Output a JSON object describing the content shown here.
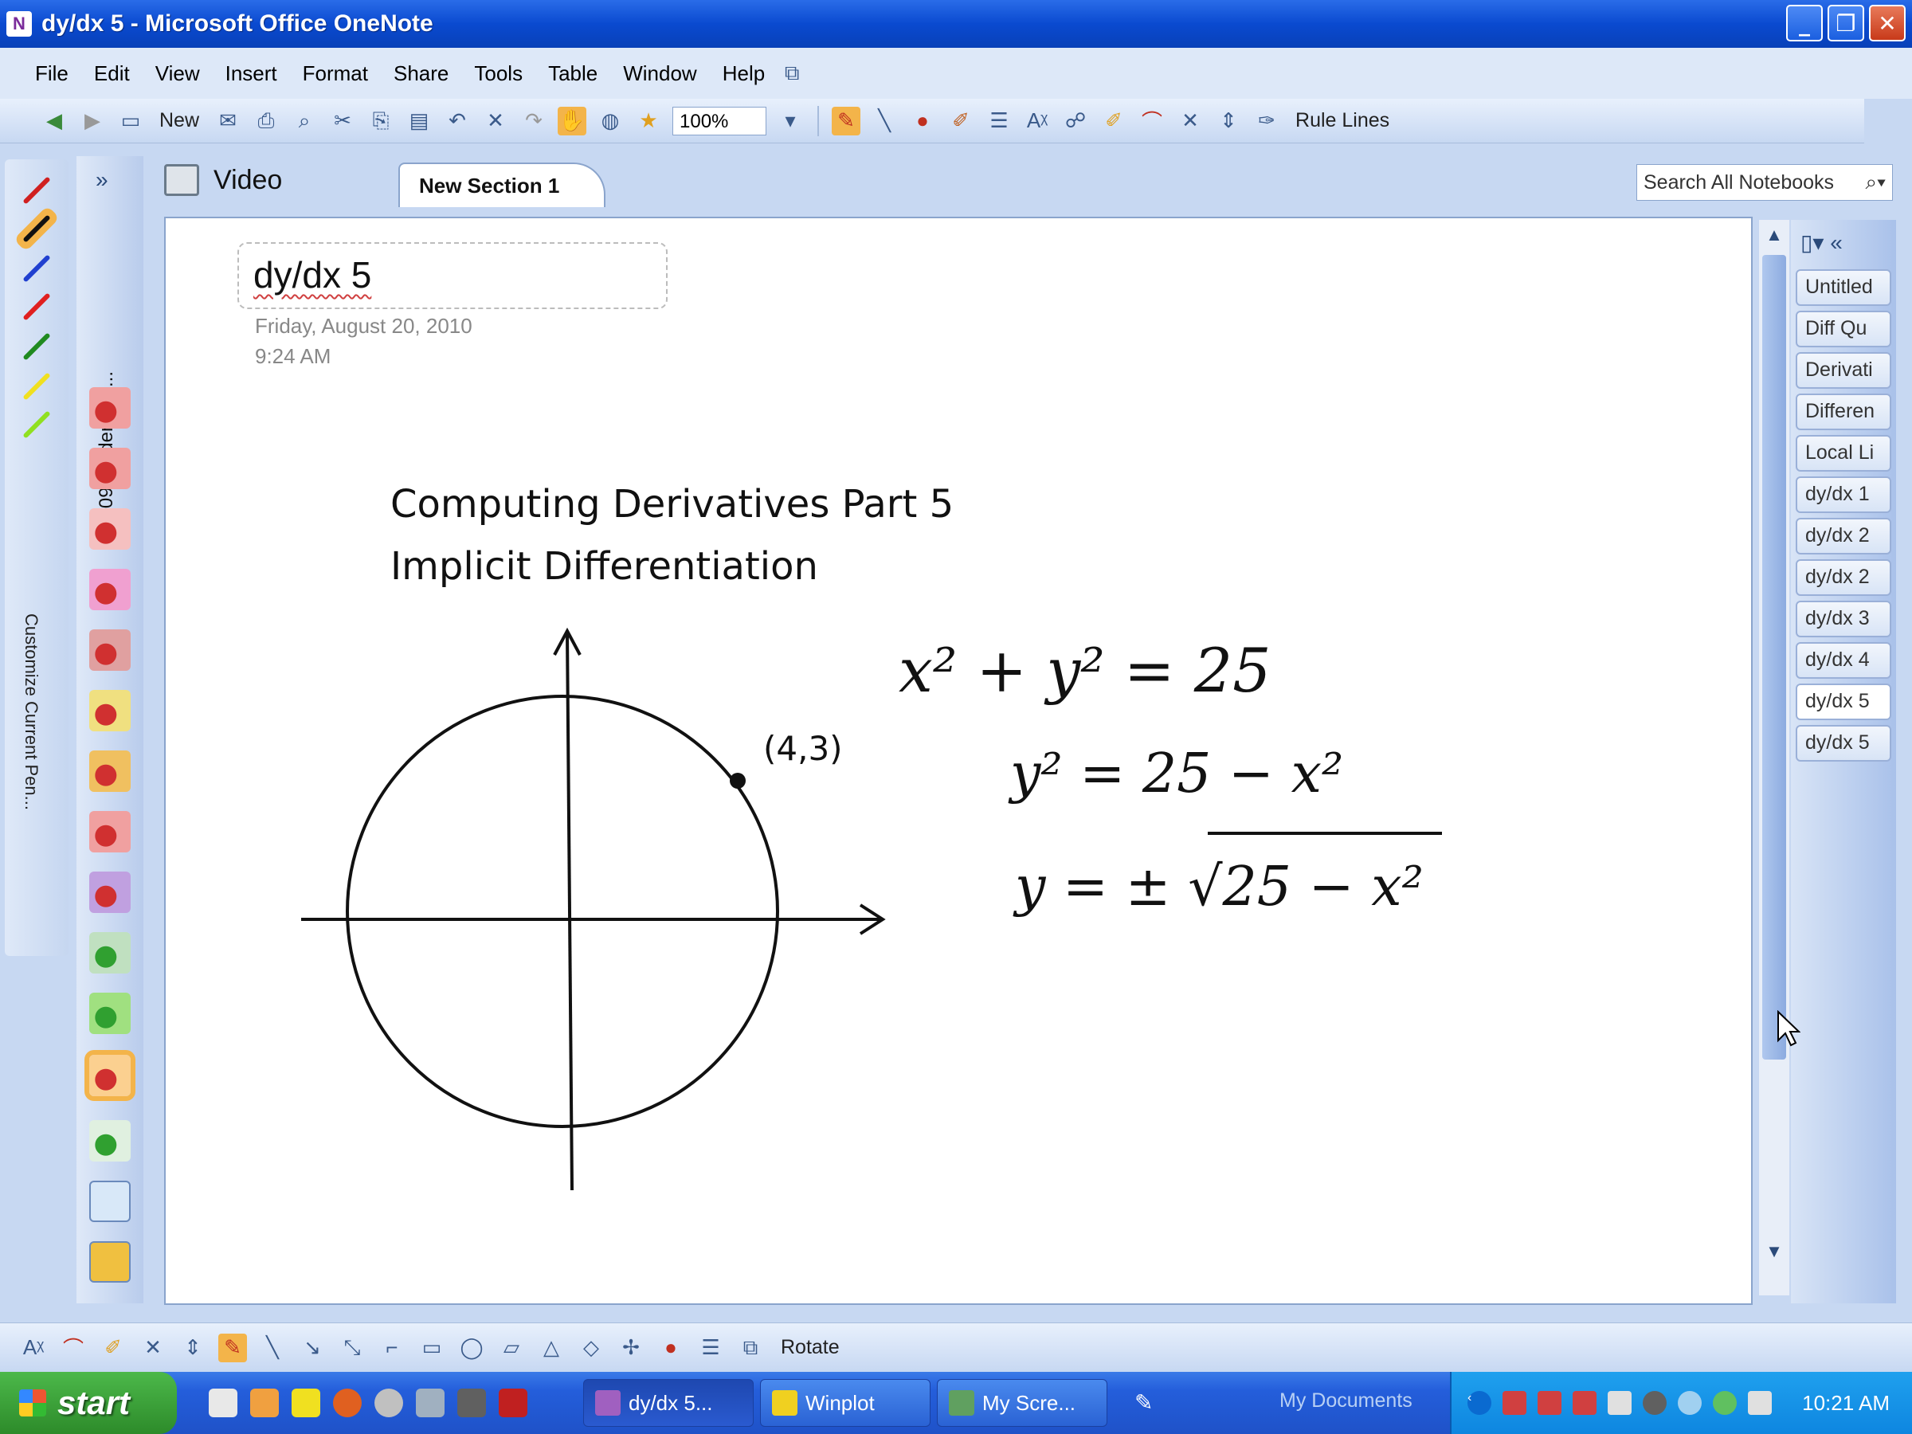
{
  "window": {
    "title": "dy/dx 5 - Microsoft Office OneNote"
  },
  "menu": [
    "File",
    "Edit",
    "View",
    "Insert",
    "Format",
    "Share",
    "Tools",
    "Table",
    "Window",
    "Help"
  ],
  "toolbar": {
    "new_label": "New",
    "zoom": "100%",
    "rule_lines": "Rule Lines"
  },
  "notebook": {
    "name": "Video",
    "section": "New Section 1",
    "nav_label": "2009 Student Su..."
  },
  "search": {
    "placeholder": "Search All Notebooks"
  },
  "pen_label": "Customize Current Pen...",
  "page": {
    "title": "dy/dx 5",
    "date": "Friday, August 20, 2010",
    "time": "9:24 AM",
    "heading_line1": "Computing Derivatives Part 5",
    "heading_line2": "Implicit Differentiation",
    "point_label": "(4,3)",
    "eq1": "x² + y² = 25",
    "eq2": "y² = 25 − x²",
    "eq3": "y = ± √25 − x²"
  },
  "page_tabs": [
    "Untitled",
    "Diff Qu",
    "Derivati",
    "Differen",
    "Local Li",
    "dy/dx 1",
    "dy/dx 2",
    "dy/dx 2",
    "dy/dx 3",
    "dy/dx 4",
    "dy/dx 5",
    "dy/dx 5"
  ],
  "drawbar": {
    "rotate_label": "Rotate"
  },
  "taskbar": {
    "start": "start",
    "tasks": [
      "dy/dx 5...",
      "Winplot",
      "My Scre..."
    ],
    "my_documents": "My Documents",
    "clock": "10:21 AM"
  }
}
